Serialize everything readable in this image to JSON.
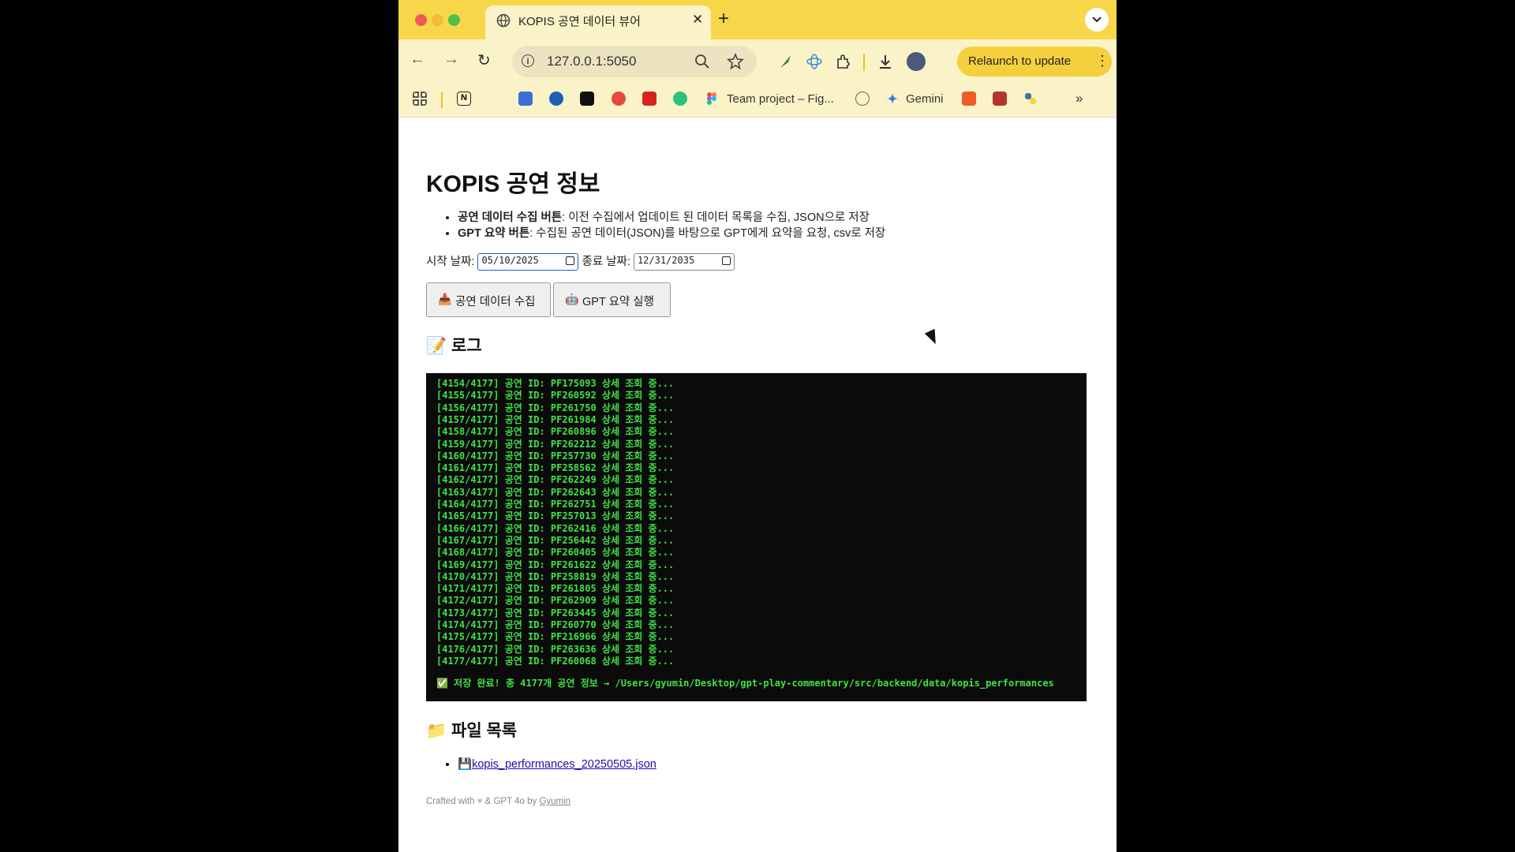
{
  "browser": {
    "tab_title": "KOPIS 공연 데이터 뷰어",
    "url": "127.0.0.1:5050",
    "relaunch_label": "Relaunch to update",
    "bookmarks": [
      {
        "label": "Team project – Fig..."
      },
      {
        "label": "Gemini"
      }
    ],
    "colors": {
      "tab_bar": "#f7d64a",
      "toolbar": "#fbf3c8",
      "relaunch": "#f5cf3c"
    }
  },
  "page": {
    "title": "KOPIS 공연 정보",
    "info": [
      {
        "bold": "공연 데이터 수집 버튼",
        "text": ": 이전 수집에서 업데이트 된 데이터 목록을 수집, JSON으로 저장"
      },
      {
        "bold": "GPT 요약 버튼",
        "text": ": 수집된 공연 데이터(JSON)를 바탕으로 GPT에게 요약을 요청, csv로 저장"
      }
    ],
    "start_date_label": "시작 날짜:",
    "start_date": "05/10/2025",
    "end_date_label": "종료 날짜:",
    "end_date": "12/31/2035",
    "collect_button": "공연 데이터 수집",
    "gpt_button": "GPT 요약 실행",
    "log_heading": "로그",
    "log_lines": [
      "[4154/4177] 공연 ID: PF175093 상세 조회 중...",
      "[4155/4177] 공연 ID: PF260592 상세 조회 중...",
      "[4156/4177] 공연 ID: PF261750 상세 조회 중...",
      "[4157/4177] 공연 ID: PF261984 상세 조회 중...",
      "[4158/4177] 공연 ID: PF260896 상세 조회 중...",
      "[4159/4177] 공연 ID: PF262212 상세 조회 중...",
      "[4160/4177] 공연 ID: PF257730 상세 조회 중...",
      "[4161/4177] 공연 ID: PF258562 상세 조회 중...",
      "[4162/4177] 공연 ID: PF262249 상세 조회 중...",
      "[4163/4177] 공연 ID: PF262643 상세 조회 중...",
      "[4164/4177] 공연 ID: PF262751 상세 조회 중...",
      "[4165/4177] 공연 ID: PF257013 상세 조회 중...",
      "[4166/4177] 공연 ID: PF262416 상세 조회 중...",
      "[4167/4177] 공연 ID: PF256442 상세 조회 중...",
      "[4168/4177] 공연 ID: PF260405 상세 조회 중...",
      "[4169/4177] 공연 ID: PF261622 상세 조회 중...",
      "[4170/4177] 공연 ID: PF258819 상세 조회 중...",
      "[4171/4177] 공연 ID: PF261805 상세 조회 중...",
      "[4172/4177] 공연 ID: PF262909 상세 조회 중...",
      "[4173/4177] 공연 ID: PF263445 상세 조회 중...",
      "[4174/4177] 공연 ID: PF260770 상세 조회 중...",
      "[4175/4177] 공연 ID: PF216966 상세 조회 중...",
      "[4176/4177] 공연 ID: PF263636 상세 조회 중...",
      "[4177/4177] 공연 ID: PF260068 상세 조회 중..."
    ],
    "log_done": "✅ 저장 완료! 총 4177개 공연 정보 → /Users/gyumin/Desktop/gpt-play-commentary/src/backend/data/kopis_performances",
    "files_heading": "파일 목록",
    "files": [
      "kopis_performances_20250505.json"
    ],
    "footer_prefix": "Crafted with",
    "footer_middle": "& GPT 4o by",
    "footer_author": "Gyumin",
    "colors": {
      "log_bg": "#0b0b0b",
      "log_text": "#3ee346",
      "link": "#1a0dab"
    }
  }
}
